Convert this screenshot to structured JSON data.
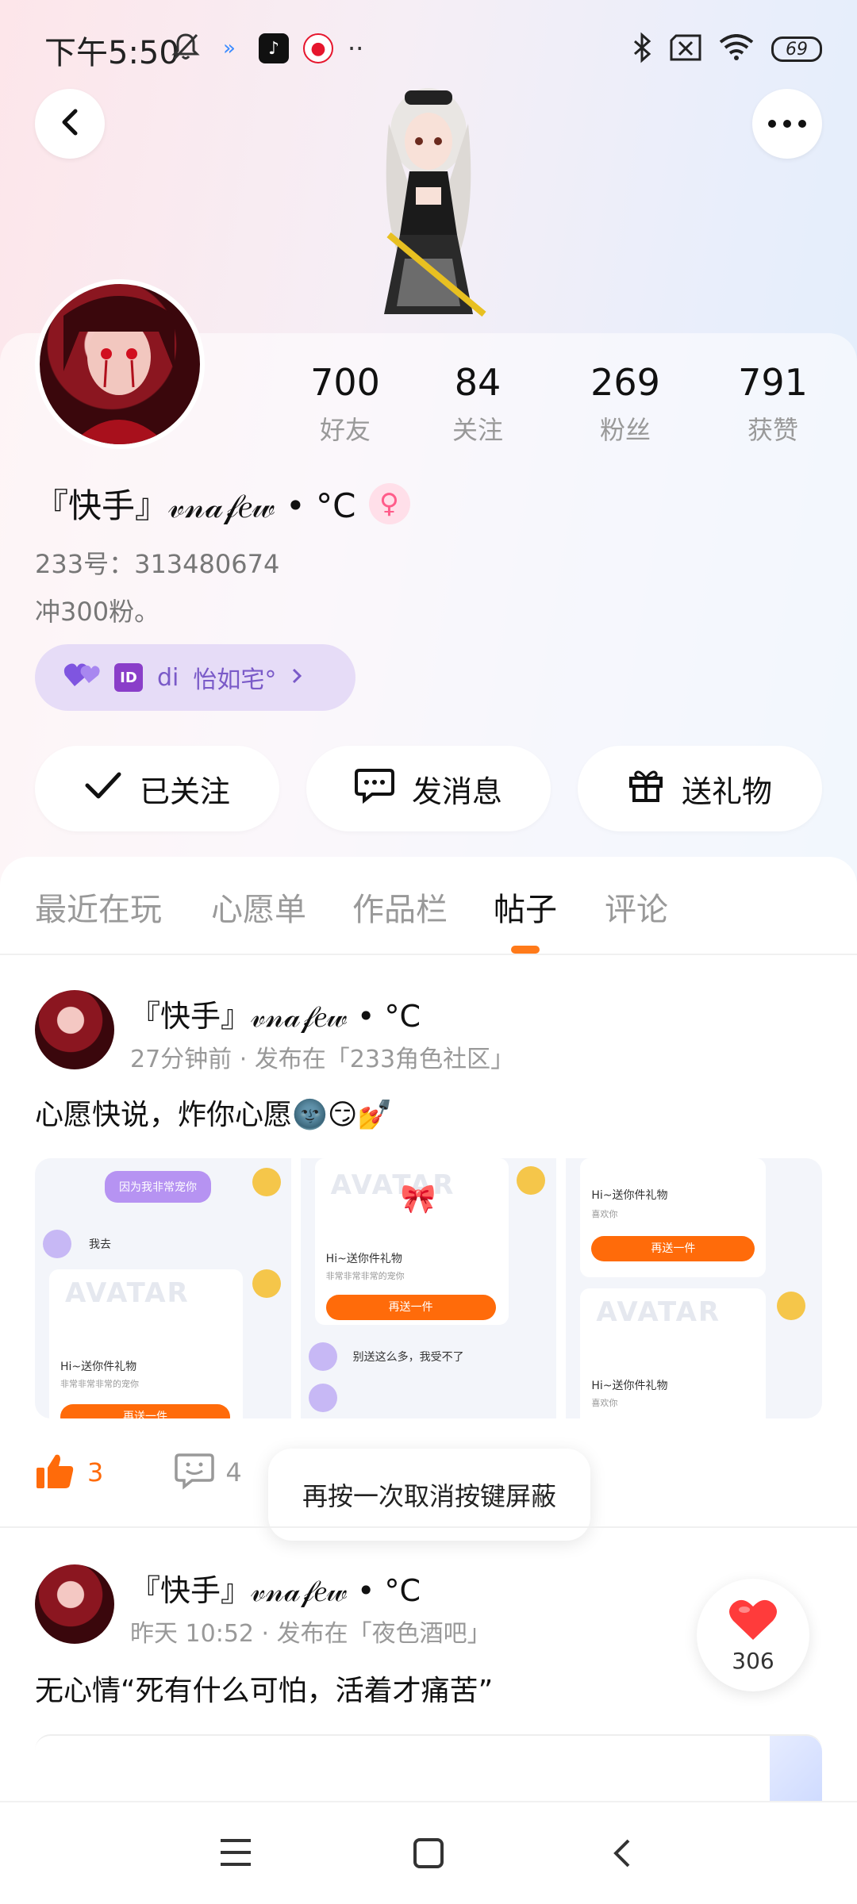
{
  "status_bar": {
    "time": "下午5:50",
    "battery": "69"
  },
  "header": {
    "back_icon": "chevron-left-icon",
    "more_icon": "more-dots-icon"
  },
  "profile": {
    "stats": [
      {
        "value": "700",
        "label": "好友"
      },
      {
        "value": "84",
        "label": "关注"
      },
      {
        "value": "269",
        "label": "粉丝"
      },
      {
        "value": "791",
        "label": "获赞"
      }
    ],
    "name": "『快手』𝓋𝓃𝒶𝒻𝑒𝓌 • °C",
    "gender_symbol": "♀",
    "uid": "233号：313480674",
    "signature": "冲300粉。",
    "badge": {
      "id_label": "ID",
      "prefix": "di",
      "name": "怡如宅°"
    }
  },
  "actions": {
    "follow": "已关注",
    "message": "发消息",
    "gift": "送礼物"
  },
  "tabs": [
    "最近在玩",
    "心愿单",
    "作品栏",
    "帖子",
    "评论"
  ],
  "active_tab": "帖子",
  "post1": {
    "author": "『快手』𝓋𝓃𝒶𝒻𝑒𝓌 • °C",
    "time": "27分钟前",
    "location": "发布在「233角色社区」",
    "text": "心愿快说，炸你心愿🌚😏💅",
    "likes": "3",
    "comments": "4",
    "images": {
      "img1": {
        "bubble": "因为我非常宠你",
        "reply": "我去",
        "gift_title": "Hi~送你件礼物",
        "gift_sub": "非常非常非常的宠你",
        "btn": "再送一件"
      },
      "img2": {
        "gift_title": "Hi~送你件礼物",
        "gift_sub": "非常非常非常的宠你",
        "btn": "再送一件",
        "reply": "别送这么多，我受不了"
      },
      "img3": {
        "gift_title_top": "Hi~送你件礼物",
        "gift_sub_top": "喜欢你",
        "btn": "再送一件",
        "gift_title": "Hi~送你件礼物",
        "gift_sub": "喜欢你"
      },
      "watermark": "AVATAR"
    }
  },
  "toast": "再按一次取消按键屏蔽",
  "post2": {
    "author": "『快手』𝓋𝓃𝒶𝒻𝑒𝓌 • °C",
    "time": "昨天 10:52",
    "location": "发布在「夜色酒吧」",
    "text": "无心情“死有什么可怕，活着才痛苦”"
  },
  "fab": {
    "count": "306",
    "icon": "heart-icon",
    "color": "#ff3b3b"
  },
  "accent_color": "#ff6b0a"
}
